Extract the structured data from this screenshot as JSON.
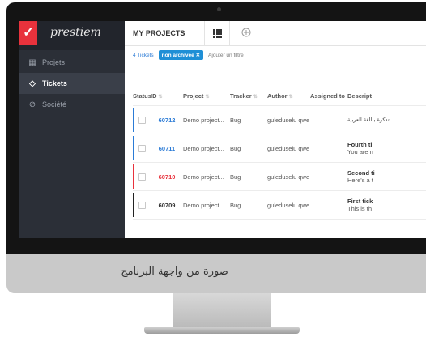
{
  "caption": "صورة من واجهة البرنامج",
  "brand": {
    "mark": "✓",
    "name": "prestiem"
  },
  "sidebar": {
    "items": [
      {
        "label": "Projets",
        "icon": "grid-icon",
        "active": false
      },
      {
        "label": "Tickets",
        "icon": "tag-icon",
        "active": true
      },
      {
        "label": "Société",
        "icon": "compass-icon",
        "active": false
      }
    ]
  },
  "header": {
    "title": "MY PROJECTS",
    "grid_icon": "grid-icon",
    "add_icon": "plus-circle-icon"
  },
  "filters": {
    "count": "4 Tickets",
    "chip": "non archivée",
    "chip_close": "✕",
    "add_filter": "Ajouter un filtre"
  },
  "table": {
    "columns": [
      "Status",
      "ID",
      "Project",
      "Tracker",
      "Author",
      "Assigned to",
      "Descript"
    ],
    "rows": [
      {
        "id": "60712",
        "project": "Demo project...",
        "tracker": "Bug",
        "author": "guleduselu qwe",
        "desc_title": "تذكرة باللغة العربية",
        "desc_body": "",
        "bar_color": "#2b7bd6",
        "id_color": "blue"
      },
      {
        "id": "60711",
        "project": "Demo project...",
        "tracker": "Bug",
        "author": "guleduselu qwe",
        "desc_title": "Fourth ti",
        "desc_body": "You are n",
        "bar_color": "#2b7bd6",
        "id_color": "blue"
      },
      {
        "id": "60710",
        "project": "Demo project...",
        "tracker": "Bug",
        "author": "guleduselu qwe",
        "desc_title": "Second ti",
        "desc_body": "Here's a t",
        "bar_color": "#e8323c",
        "id_color": "red"
      },
      {
        "id": "60709",
        "project": "Demo project...",
        "tracker": "Bug",
        "author": "guleduselu qwe",
        "desc_title": "First tick",
        "desc_body": "This is th",
        "bar_color": "#222222",
        "id_color": "dark"
      }
    ]
  },
  "colors": {
    "accent": "#e8323c",
    "link": "#2b7bd6",
    "chip": "#1f8fd6",
    "sidebar": "#2b2f37"
  }
}
